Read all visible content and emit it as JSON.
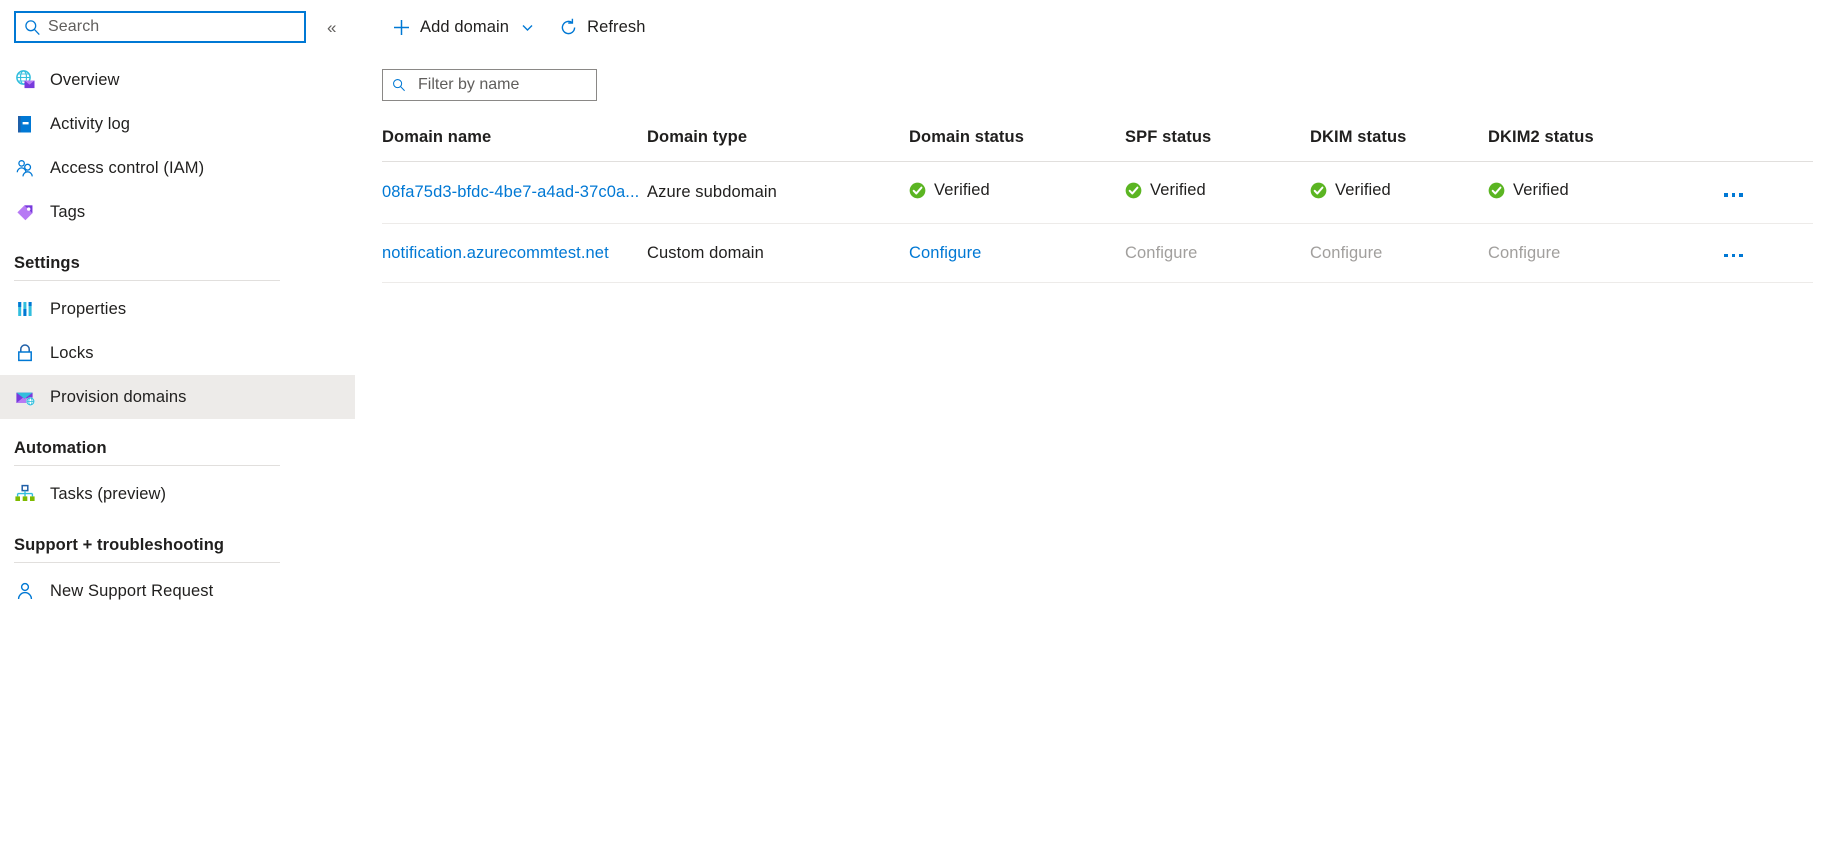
{
  "sidebar": {
    "search": {
      "placeholder": "Search",
      "icon": "search-icon"
    },
    "collapse_label": "«",
    "top_items": [
      {
        "label": "Overview",
        "icon": "overview-globe-mail-icon"
      },
      {
        "label": "Activity log",
        "icon": "activity-log-book-icon"
      },
      {
        "label": "Access control (IAM)",
        "icon": "access-control-people-icon"
      },
      {
        "label": "Tags",
        "icon": "tags-icon"
      }
    ],
    "groups": [
      {
        "title": "Settings",
        "items": [
          {
            "label": "Properties",
            "icon": "properties-bars-icon",
            "selected": false
          },
          {
            "label": "Locks",
            "icon": "locks-padlock-icon",
            "selected": false
          },
          {
            "label": "Provision domains",
            "icon": "provision-domains-mail-globe-icon",
            "selected": true
          }
        ]
      },
      {
        "title": "Automation",
        "items": [
          {
            "label": "Tasks (preview)",
            "icon": "tasks-hierarchy-icon",
            "selected": false
          }
        ]
      },
      {
        "title": "Support + troubleshooting",
        "items": [
          {
            "label": "New Support Request",
            "icon": "support-person-icon",
            "selected": false
          }
        ]
      }
    ]
  },
  "toolbar": {
    "add_domain_label": "Add domain",
    "add_domain_icon": "plus-icon",
    "add_domain_caret_icon": "chevron-down-icon",
    "refresh_label": "Refresh",
    "refresh_icon": "refresh-icon"
  },
  "filter": {
    "placeholder": "Filter by name",
    "value": "",
    "icon": "search-icon"
  },
  "table": {
    "columns": [
      "Domain name",
      "Domain type",
      "Domain status",
      "SPF status",
      "DKIM status",
      "DKIM2 status"
    ],
    "rows": [
      {
        "domain_name": "08fa75d3-bfdc-4be7-a4ad-37c0a...",
        "domain_type": "Azure subdomain",
        "domain_status": {
          "text": "Verified",
          "state": "verified"
        },
        "spf_status": {
          "text": "Verified",
          "state": "verified"
        },
        "dkim_status": {
          "text": "Verified",
          "state": "verified"
        },
        "dkim2_status": {
          "text": "Verified",
          "state": "verified"
        },
        "menu_label": "..."
      },
      {
        "domain_name": "notification.azurecommtest.net",
        "domain_type": "Custom domain",
        "domain_status": {
          "text": "Configure",
          "state": "link"
        },
        "spf_status": {
          "text": "Configure",
          "state": "disabled"
        },
        "dkim_status": {
          "text": "Configure",
          "state": "disabled"
        },
        "dkim2_status": {
          "text": "Configure",
          "state": "disabled"
        },
        "menu_label": "..."
      }
    ]
  },
  "colors": {
    "accent": "#0078d4",
    "verified_green": "#5bb522",
    "disabled_text": "#a19f9d",
    "selected_bg": "#edebe9",
    "divider": "#e1dfdd"
  }
}
